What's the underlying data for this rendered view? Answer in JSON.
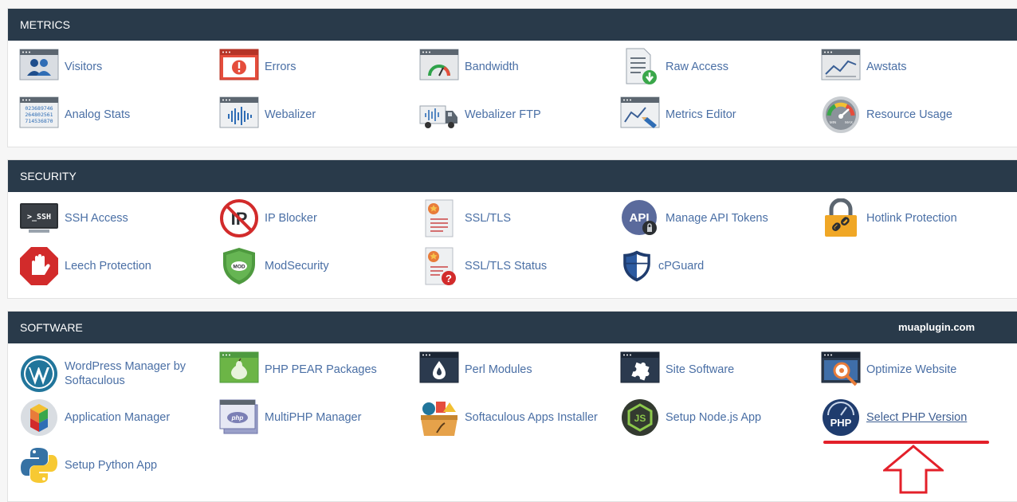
{
  "sections": [
    {
      "title": "METRICS",
      "items": [
        {
          "label": "Visitors",
          "icon": "visitors-icon"
        },
        {
          "label": "Errors",
          "icon": "errors-icon"
        },
        {
          "label": "Bandwidth",
          "icon": "bandwidth-icon"
        },
        {
          "label": "Raw Access",
          "icon": "raw-access-icon"
        },
        {
          "label": "Awstats",
          "icon": "awstats-icon"
        },
        {
          "label": "Analog Stats",
          "icon": "analog-stats-icon",
          "icon_text": [
            "023689746",
            "264802561",
            "714536870"
          ]
        },
        {
          "label": "Webalizer",
          "icon": "webalizer-icon"
        },
        {
          "label": "Webalizer FTP",
          "icon": "webalizer-ftp-icon"
        },
        {
          "label": "Metrics Editor",
          "icon": "metrics-editor-icon"
        },
        {
          "label": "Resource Usage",
          "icon": "resource-usage-icon",
          "icon_text": [
            "MIN",
            "MAX"
          ]
        }
      ]
    },
    {
      "title": "SECURITY",
      "items": [
        {
          "label": "SSH Access",
          "icon": "ssh-terminal-icon",
          "icon_text": ">_SSH"
        },
        {
          "label": "IP Blocker",
          "icon": "ip-blocker-icon",
          "icon_text": "IP"
        },
        {
          "label": "SSL/TLS",
          "icon": "ssl-certificate-icon"
        },
        {
          "label": "Manage API Tokens",
          "icon": "api-token-icon",
          "icon_text": "API"
        },
        {
          "label": "Hotlink Protection",
          "icon": "hotlink-lock-icon"
        },
        {
          "label": "Leech Protection",
          "icon": "leech-hand-icon"
        },
        {
          "label": "ModSecurity",
          "icon": "modsecurity-shield-icon",
          "icon_text": "MOD"
        },
        {
          "label": "SSL/TLS Status",
          "icon": "ssl-status-icon",
          "icon_text": "?"
        },
        {
          "label": "cPGuard",
          "icon": "cpguard-shield-icon"
        }
      ]
    },
    {
      "title": "SOFTWARE",
      "watermark": "muaplugin.com",
      "items": [
        {
          "label": "WordPress Manager by Softaculous",
          "icon": "wordpress-icon"
        },
        {
          "label": "PHP PEAR Packages",
          "icon": "php-pear-icon"
        },
        {
          "label": "Perl Modules",
          "icon": "perl-modules-icon"
        },
        {
          "label": "Site Software",
          "icon": "site-software-puzzle-icon"
        },
        {
          "label": "Optimize Website",
          "icon": "optimize-website-icon"
        },
        {
          "label": "Application Manager",
          "icon": "application-manager-icon"
        },
        {
          "label": "MultiPHP Manager",
          "icon": "multiphp-icon",
          "icon_text": "php"
        },
        {
          "label": "Softaculous Apps Installer",
          "icon": "softaculous-icon"
        },
        {
          "label": "Setup Node.js App",
          "icon": "nodejs-icon",
          "icon_text": "JS"
        },
        {
          "label": "Select PHP Version",
          "icon": "select-php-version-icon",
          "icon_text": "PHP"
        },
        {
          "label": "Setup Python App",
          "icon": "python-icon"
        }
      ]
    }
  ],
  "colors": {
    "header": "#293a4a",
    "link": "#4a6fa5",
    "annotation": "#e3202a"
  }
}
